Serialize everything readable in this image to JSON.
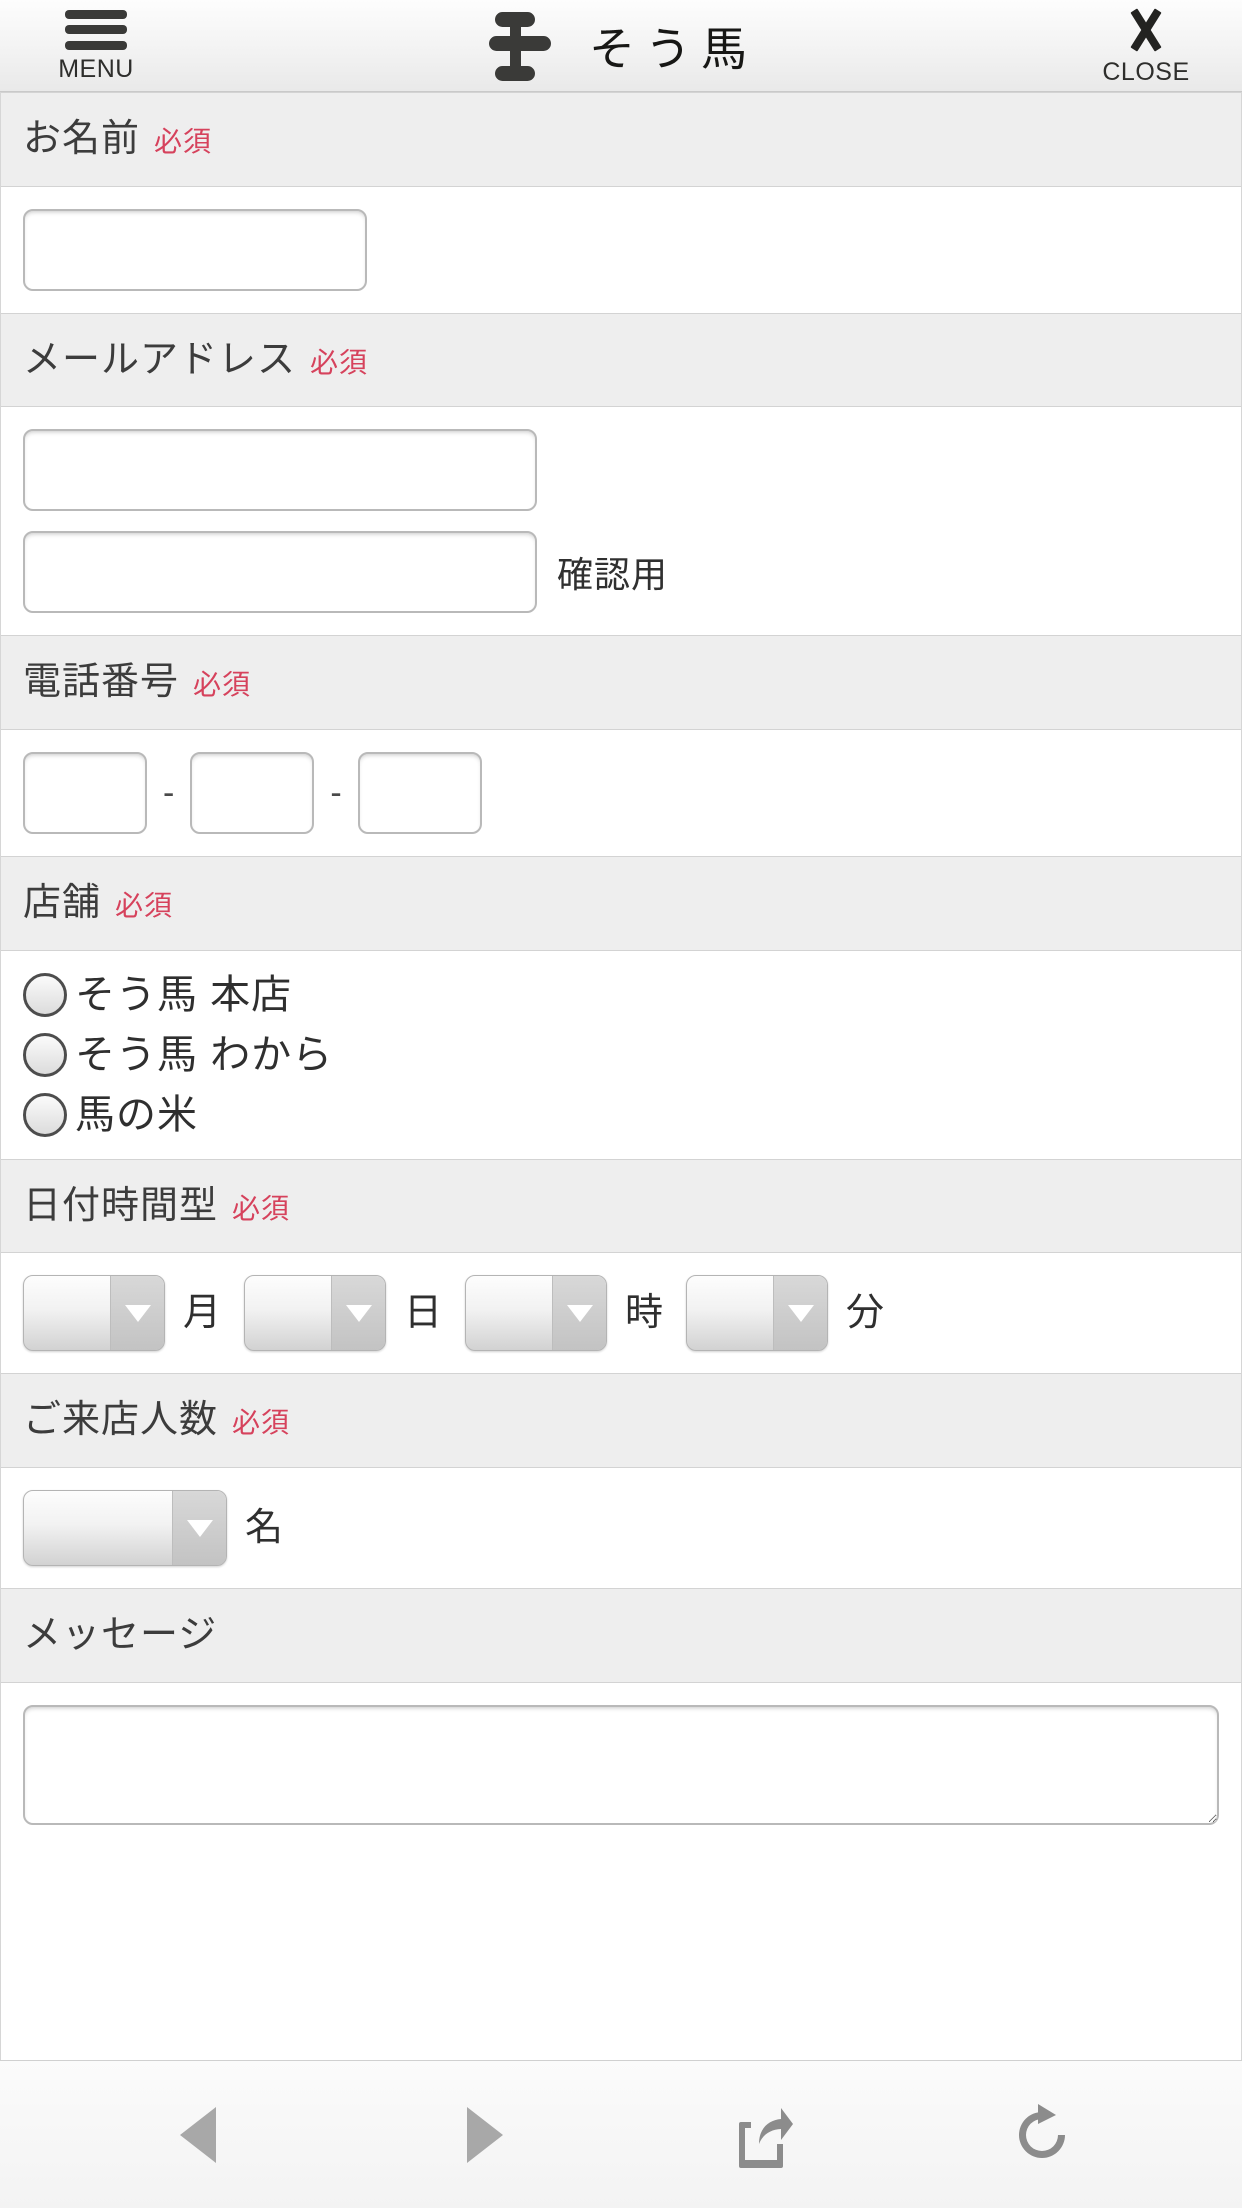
{
  "header": {
    "menu_label": "MENU",
    "menu_icon": "hamburger-icon",
    "close_label": "CLOSE",
    "close_icon": "close-x-icon",
    "brand_text": "そう馬",
    "brand_mark_icon": "soma-logo-mark"
  },
  "sections": {
    "name": {
      "title": "お名前",
      "required_label": "必須",
      "input_value": "",
      "placeholder": ""
    },
    "email": {
      "title": "メールアドレス",
      "required_label": "必須",
      "input_value": "",
      "confirm_value": "",
      "confirm_label": "確認用",
      "placeholder": ""
    },
    "tel": {
      "title": "電話番号",
      "required_label": "必須",
      "part1": "",
      "part2": "",
      "part3": "",
      "separator": "-"
    },
    "store": {
      "title": "店舗",
      "required_label": "必須",
      "options": [
        {
          "label": "そう馬 本店",
          "selected": false
        },
        {
          "label": "そう馬 わから",
          "selected": false
        },
        {
          "label": "馬の米",
          "selected": false
        }
      ]
    },
    "datetime": {
      "title": "日付時間型",
      "required_label": "必須",
      "month_value": "",
      "month_unit": "月",
      "day_value": "",
      "day_unit": "日",
      "hour_value": "",
      "hour_unit": "時",
      "minute_value": "",
      "minute_unit": "分"
    },
    "people": {
      "title": "ご来店人数",
      "required_label": "必須",
      "count_value": "",
      "unit": "名"
    },
    "message": {
      "title": "メッセージ",
      "input_value": "",
      "placeholder": ""
    }
  },
  "toolbar": {
    "back_icon": "back-triangle-icon",
    "forward_icon": "forward-triangle-icon",
    "share_icon": "share-icon",
    "reload_icon": "reload-icon"
  },
  "colors": {
    "required_red": "#d6425c",
    "section_head_bg": "#eeeeee",
    "text": "#3c3c3c",
    "chrome_gray": "#8a8a8a"
  }
}
